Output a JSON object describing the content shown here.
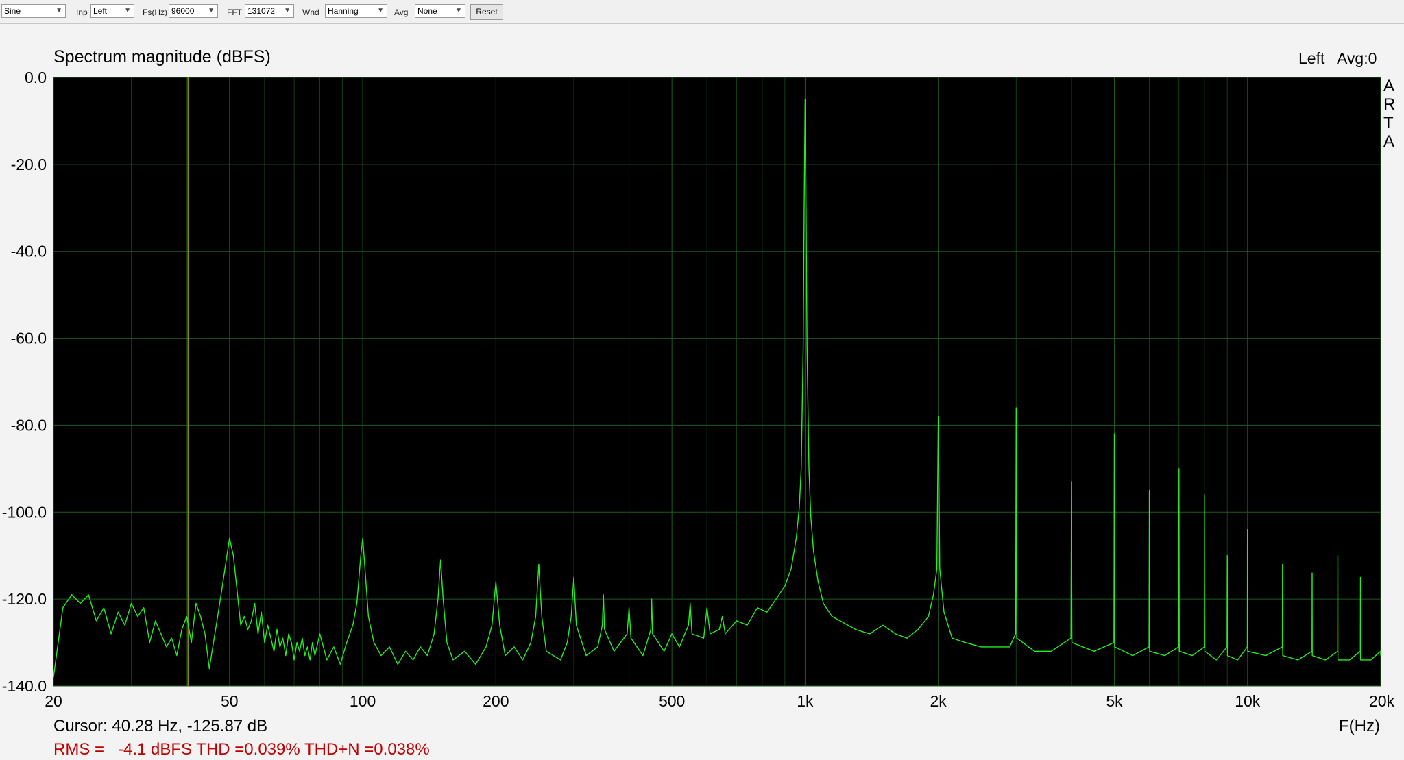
{
  "toolbar": {
    "generator": {
      "value": "Sine"
    },
    "input": {
      "label": "Inp",
      "value": "Left"
    },
    "fs": {
      "label": "Fs(Hz)",
      "value": "96000"
    },
    "fft": {
      "label": "FFT",
      "value": "131072"
    },
    "window": {
      "label": "Wnd",
      "value": "Hanning"
    },
    "avg": {
      "label": "Avg",
      "value": "None"
    },
    "reset_label": "Reset"
  },
  "colors": {
    "plot_background": "#000000",
    "grid": "#1f5a1f",
    "trace": "#22ee22",
    "status": "#c00000",
    "marker": "#8a8a00"
  },
  "chart_data": {
    "type": "line",
    "title": "Spectrum magnitude (dBFS)",
    "channel_label": "Left",
    "avg_label": "Avg:0",
    "brand_letters": [
      "A",
      "R",
      "T",
      "A"
    ],
    "xlabel": "F(Hz)",
    "ylabel": "",
    "x_scale": "log",
    "xlim": [
      20,
      20000
    ],
    "ylim": [
      -140,
      0
    ],
    "grid": true,
    "x_ticks": [
      {
        "value": 20,
        "label": "20"
      },
      {
        "value": 50,
        "label": "50"
      },
      {
        "value": 100,
        "label": "100"
      },
      {
        "value": 200,
        "label": "200"
      },
      {
        "value": 500,
        "label": "500"
      },
      {
        "value": 1000,
        "label": "1k"
      },
      {
        "value": 2000,
        "label": "2k"
      },
      {
        "value": 5000,
        "label": "5k"
      },
      {
        "value": 10000,
        "label": "10k"
      },
      {
        "value": 20000,
        "label": "20k"
      }
    ],
    "y_ticks": [
      {
        "value": 0,
        "label": "0.0"
      },
      {
        "value": -20,
        "label": "-20.0"
      },
      {
        "value": -40,
        "label": "-40.0"
      },
      {
        "value": -60,
        "label": "-60.0"
      },
      {
        "value": -80,
        "label": "-80.0"
      },
      {
        "value": -100,
        "label": "-100.0"
      },
      {
        "value": -120,
        "label": "-120.0"
      },
      {
        "value": -140,
        "label": "-140.0"
      }
    ],
    "cursor_hz": 40.28,
    "series": [
      {
        "points": [
          [
            20,
            -138
          ],
          [
            21,
            -122
          ],
          [
            22,
            -119
          ],
          [
            23,
            -121
          ],
          [
            24,
            -119
          ],
          [
            25,
            -125
          ],
          [
            26,
            -122
          ],
          [
            27,
            -128
          ],
          [
            28,
            -123
          ],
          [
            29,
            -126
          ],
          [
            30,
            -121
          ],
          [
            31,
            -124
          ],
          [
            32,
            -122
          ],
          [
            33,
            -130
          ],
          [
            34,
            -125
          ],
          [
            35,
            -128
          ],
          [
            36,
            -131
          ],
          [
            37,
            -129
          ],
          [
            38,
            -133
          ],
          [
            39,
            -127
          ],
          [
            40,
            -124
          ],
          [
            41,
            -130
          ],
          [
            42,
            -121
          ],
          [
            43,
            -124
          ],
          [
            44,
            -128
          ],
          [
            45,
            -136
          ],
          [
            46,
            -130
          ],
          [
            47,
            -124
          ],
          [
            48,
            -118
          ],
          [
            49,
            -112
          ],
          [
            50,
            -106
          ],
          [
            51,
            -110
          ],
          [
            52,
            -118
          ],
          [
            53,
            -126
          ],
          [
            54,
            -124
          ],
          [
            55,
            -127
          ],
          [
            56,
            -125
          ],
          [
            57,
            -121
          ],
          [
            58,
            -128
          ],
          [
            59,
            -123
          ],
          [
            60,
            -130
          ],
          [
            61,
            -126
          ],
          [
            62,
            -129
          ],
          [
            63,
            -132
          ],
          [
            64,
            -127
          ],
          [
            65,
            -131
          ],
          [
            66,
            -129
          ],
          [
            67,
            -133
          ],
          [
            68,
            -128
          ],
          [
            69,
            -130
          ],
          [
            70,
            -134
          ],
          [
            71,
            -130
          ],
          [
            72,
            -132
          ],
          [
            73,
            -129
          ],
          [
            74,
            -133
          ],
          [
            75,
            -131
          ],
          [
            76,
            -134
          ],
          [
            77,
            -130
          ],
          [
            78,
            -133
          ],
          [
            80,
            -128
          ],
          [
            83,
            -134
          ],
          [
            86,
            -131
          ],
          [
            89,
            -135
          ],
          [
            92,
            -130
          ],
          [
            95,
            -126
          ],
          [
            97,
            -121
          ],
          [
            99,
            -110
          ],
          [
            100,
            -106
          ],
          [
            101,
            -112
          ],
          [
            103,
            -124
          ],
          [
            106,
            -130
          ],
          [
            110,
            -133
          ],
          [
            115,
            -131
          ],
          [
            120,
            -135
          ],
          [
            125,
            -132
          ],
          [
            130,
            -134
          ],
          [
            135,
            -131
          ],
          [
            140,
            -133
          ],
          [
            145,
            -128
          ],
          [
            148,
            -120
          ],
          [
            150,
            -111
          ],
          [
            152,
            -120
          ],
          [
            155,
            -130
          ],
          [
            160,
            -134
          ],
          [
            170,
            -132
          ],
          [
            180,
            -135
          ],
          [
            190,
            -131
          ],
          [
            196,
            -126
          ],
          [
            200,
            -116
          ],
          [
            204,
            -126
          ],
          [
            210,
            -133
          ],
          [
            220,
            -131
          ],
          [
            230,
            -134
          ],
          [
            240,
            -130
          ],
          [
            246,
            -124
          ],
          [
            250,
            -112
          ],
          [
            254,
            -124
          ],
          [
            260,
            -132
          ],
          [
            280,
            -134
          ],
          [
            290,
            -130
          ],
          [
            296,
            -124
          ],
          [
            300,
            -115
          ],
          [
            304,
            -126
          ],
          [
            320,
            -133
          ],
          [
            340,
            -131
          ],
          [
            348,
            -126
          ],
          [
            350,
            -119
          ],
          [
            352,
            -127
          ],
          [
            370,
            -132
          ],
          [
            396,
            -128
          ],
          [
            400,
            -122
          ],
          [
            404,
            -129
          ],
          [
            430,
            -133
          ],
          [
            448,
            -127
          ],
          [
            450,
            -120
          ],
          [
            452,
            -128
          ],
          [
            480,
            -132
          ],
          [
            500,
            -128
          ],
          [
            520,
            -131
          ],
          [
            545,
            -126
          ],
          [
            550,
            -121
          ],
          [
            555,
            -128
          ],
          [
            590,
            -129
          ],
          [
            600,
            -122
          ],
          [
            610,
            -128
          ],
          [
            640,
            -127
          ],
          [
            650,
            -124
          ],
          [
            660,
            -128
          ],
          [
            700,
            -125
          ],
          [
            740,
            -126
          ],
          [
            780,
            -122
          ],
          [
            820,
            -123
          ],
          [
            860,
            -120
          ],
          [
            900,
            -117
          ],
          [
            930,
            -113
          ],
          [
            955,
            -106
          ],
          [
            970,
            -99
          ],
          [
            980,
            -90
          ],
          [
            990,
            -62
          ],
          [
            995,
            -30
          ],
          [
            1000,
            -5
          ],
          [
            1005,
            -30
          ],
          [
            1010,
            -62
          ],
          [
            1020,
            -90
          ],
          [
            1030,
            -101
          ],
          [
            1045,
            -109
          ],
          [
            1070,
            -116
          ],
          [
            1100,
            -121
          ],
          [
            1150,
            -124
          ],
          [
            1200,
            -125
          ],
          [
            1300,
            -127
          ],
          [
            1400,
            -128
          ],
          [
            1500,
            -126
          ],
          [
            1600,
            -128
          ],
          [
            1700,
            -129
          ],
          [
            1800,
            -127
          ],
          [
            1900,
            -124
          ],
          [
            1950,
            -119
          ],
          [
            1985,
            -113
          ],
          [
            2000,
            -78
          ],
          [
            2015,
            -113
          ],
          [
            2060,
            -123
          ],
          [
            2150,
            -129
          ],
          [
            2300,
            -130
          ],
          [
            2500,
            -131
          ],
          [
            2700,
            -131
          ],
          [
            2900,
            -131
          ],
          [
            2990,
            -128
          ],
          [
            3000,
            -76
          ],
          [
            3010,
            -129
          ],
          [
            3300,
            -132
          ],
          [
            3600,
            -132
          ],
          [
            3990,
            -129
          ],
          [
            4000,
            -93
          ],
          [
            4010,
            -130
          ],
          [
            4500,
            -132
          ],
          [
            4990,
            -130
          ],
          [
            5000,
            -82
          ],
          [
            5010,
            -131
          ],
          [
            5500,
            -133
          ],
          [
            5990,
            -131
          ],
          [
            6000,
            -95
          ],
          [
            6010,
            -132
          ],
          [
            6500,
            -133
          ],
          [
            6990,
            -131
          ],
          [
            7000,
            -90
          ],
          [
            7010,
            -132
          ],
          [
            7500,
            -133
          ],
          [
            7990,
            -131
          ],
          [
            8000,
            -96
          ],
          [
            8010,
            -132
          ],
          [
            8500,
            -134
          ],
          [
            8990,
            -131
          ],
          [
            9000,
            -110
          ],
          [
            9010,
            -133
          ],
          [
            9500,
            -134
          ],
          [
            9990,
            -131
          ],
          [
            10000,
            -104
          ],
          [
            10010,
            -132
          ],
          [
            11000,
            -133
          ],
          [
            11990,
            -131
          ],
          [
            12000,
            -112
          ],
          [
            12010,
            -133
          ],
          [
            13000,
            -134
          ],
          [
            13990,
            -132
          ],
          [
            14000,
            -114
          ],
          [
            14010,
            -133
          ],
          [
            15000,
            -134
          ],
          [
            15990,
            -132
          ],
          [
            16000,
            -110
          ],
          [
            16010,
            -134
          ],
          [
            17000,
            -134
          ],
          [
            17990,
            -132
          ],
          [
            18000,
            -115
          ],
          [
            18010,
            -134
          ],
          [
            19000,
            -134
          ],
          [
            19990,
            -132
          ],
          [
            20000,
            -133
          ]
        ]
      }
    ]
  },
  "status": {
    "cursor": "Cursor: 40.28 Hz, -125.87 dB",
    "measurement": "RMS =   -4.1 dBFS THD =0.039% THD+N =0.038%"
  }
}
